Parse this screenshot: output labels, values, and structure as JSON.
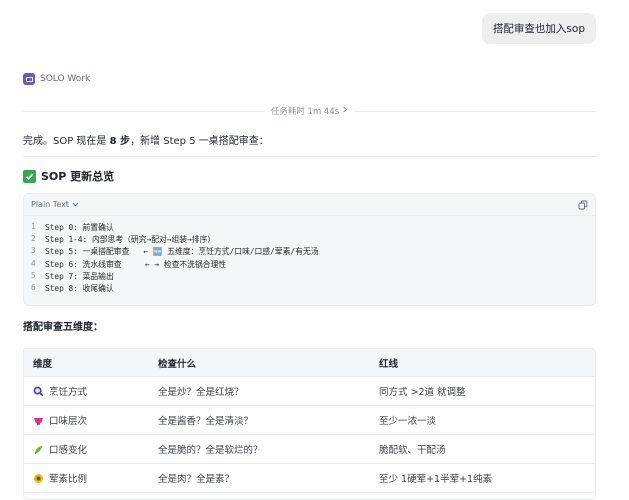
{
  "user_message": "搭配审查也加入sop",
  "agent": {
    "name": "SOLO Work"
  },
  "task_duration": "任务耗时 1m 44s",
  "summary": {
    "prefix": "完成。SOP 现在是 ",
    "steps": "8 步",
    "suffix": "，新增 Step 5 一桌搭配审查："
  },
  "section_title": "SOP 更新总览",
  "code": {
    "language": "Plain Text",
    "lines": [
      {
        "n": "1",
        "text": "Step 0: 前置确认"
      },
      {
        "n": "2",
        "text": "Step 1-4: 内部思考（研究→配对→组装→排序）"
      },
      {
        "n": "3",
        "text": "Step 5: 一桌搭配审查   ← 🆕 五维度：烹饪方式/口味/口感/荤素/有无汤"
      },
      {
        "n": "4",
        "text": "Step 6: 洗水线审查     ← → 检查不洗锅合理性"
      },
      {
        "n": "5",
        "text": "Step 7: 菜品输出"
      },
      {
        "n": "6",
        "text": "Step 8: 收尾确认"
      }
    ]
  },
  "dimensions_title": "搭配审查五维度：",
  "table": {
    "headers": [
      "维度",
      "检查什么",
      "红线"
    ],
    "rows": [
      {
        "icon": "magnifier-icon",
        "dim": "烹饪方式",
        "check": "全是炒？全是红烧？",
        "line": "同方式 >2道 就调整"
      },
      {
        "icon": "bowl-icon",
        "dim": "口味层次",
        "check": "全是酱香？全是清淡？",
        "line": "至少一浓一淡"
      },
      {
        "icon": "leaf-icon",
        "dim": "口感变化",
        "check": "全是脆的？全是软烂的？",
        "line": "脆配软、干配汤"
      },
      {
        "icon": "circle-icon",
        "dim": "荤素比例",
        "check": "全是肉？全是素？",
        "line": "至少 1硬荤+1半荤+1纯素"
      }
    ]
  },
  "colors": {
    "accent_purple": "#6a56c9",
    "check_green": "#34a853"
  }
}
